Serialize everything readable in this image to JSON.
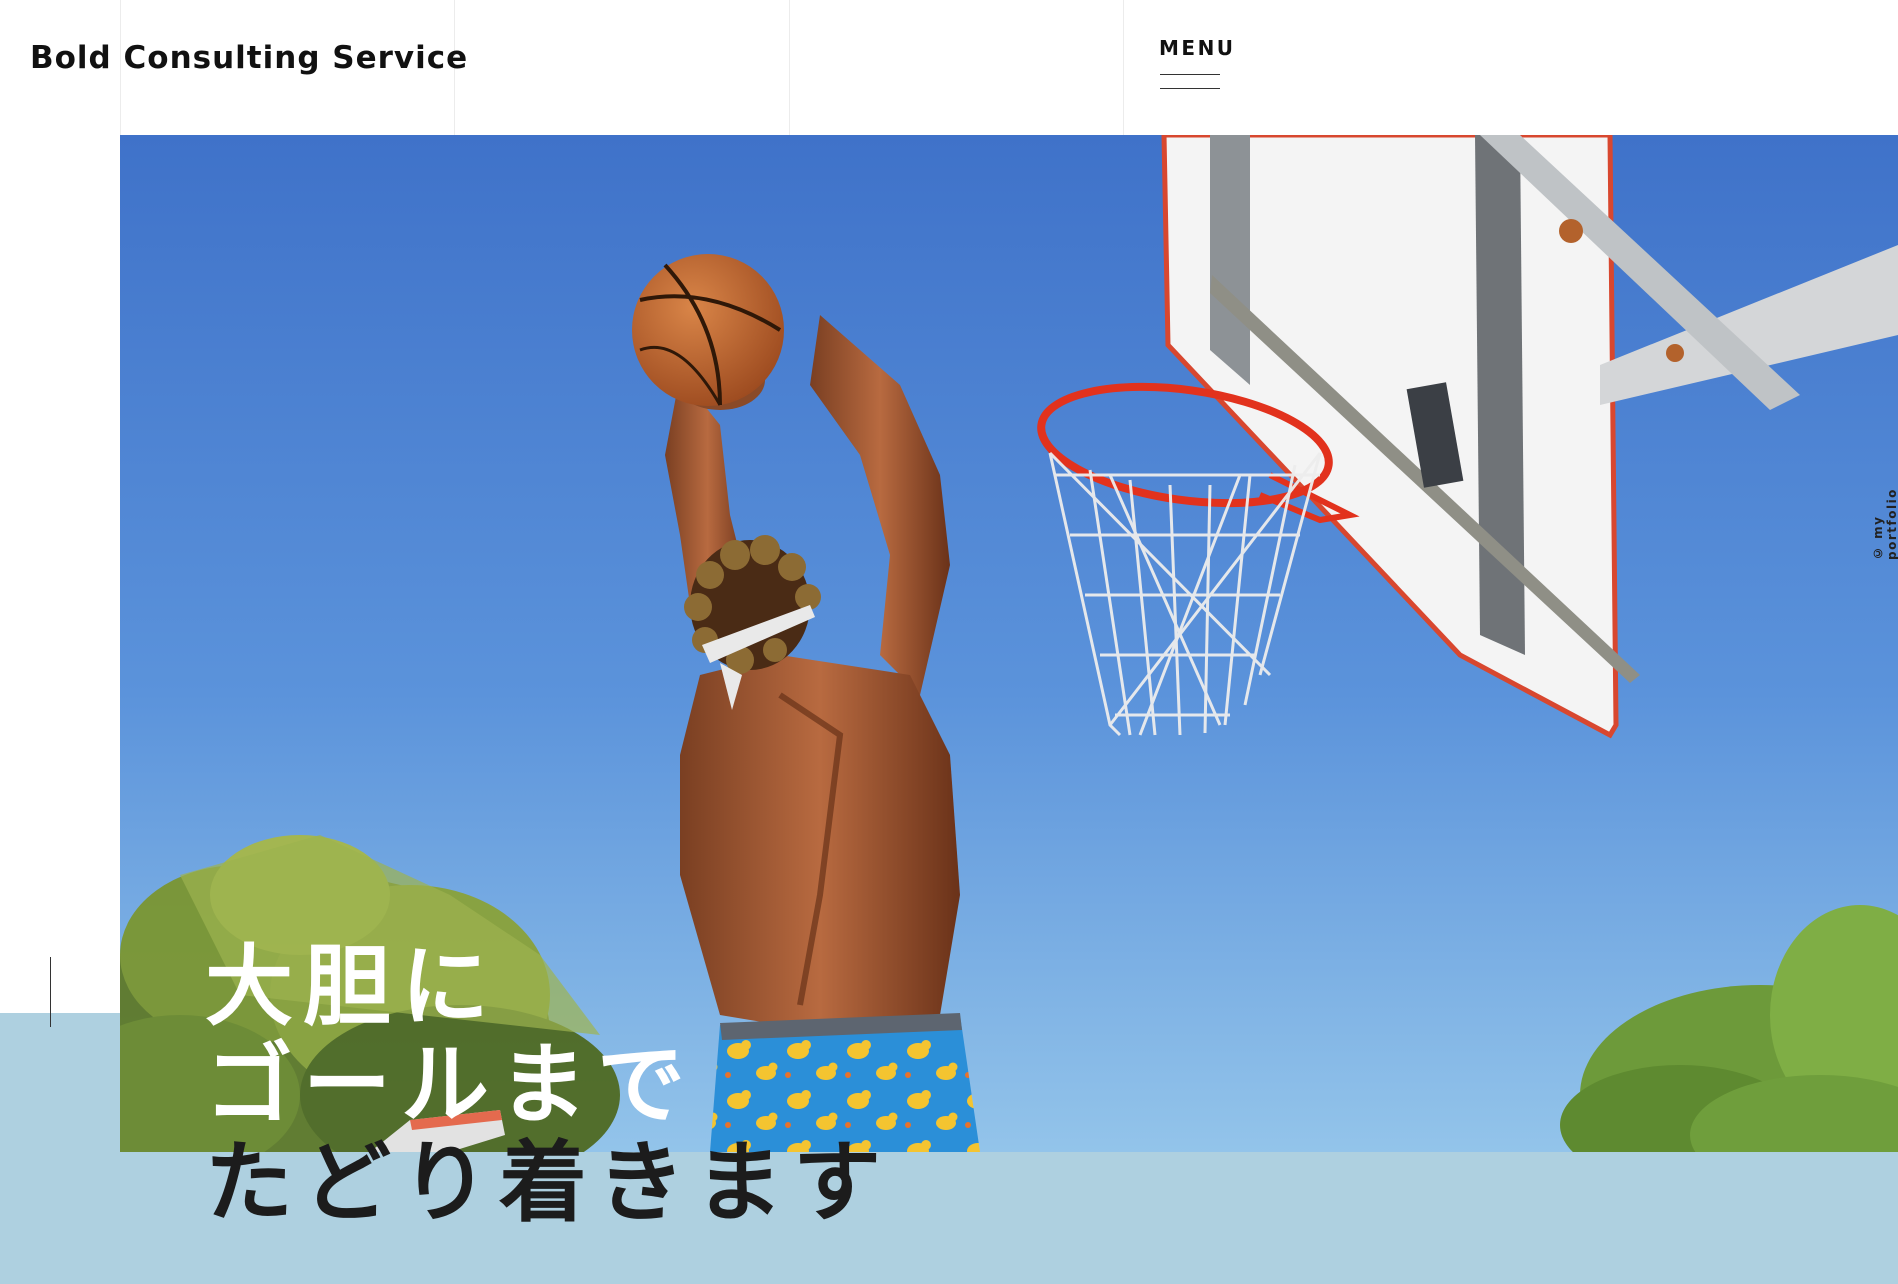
{
  "header": {
    "brand": "Bold Consulting Service",
    "menu_label": "MENU"
  },
  "hero": {
    "headline_lines": [
      "大胆に",
      "ゴールまで",
      "たどり着きます"
    ],
    "image_description_icon": "basketball-dunk-photo",
    "credit": "© my portfolio"
  },
  "colors": {
    "band": "#aed0e0",
    "sky_top": "#3f77cc",
    "sky_bottom": "#8fc0e8",
    "text_dark": "#1c1c1c",
    "text_light": "#ffffff",
    "rim": "#e0321e",
    "ball": "#c86a32"
  }
}
